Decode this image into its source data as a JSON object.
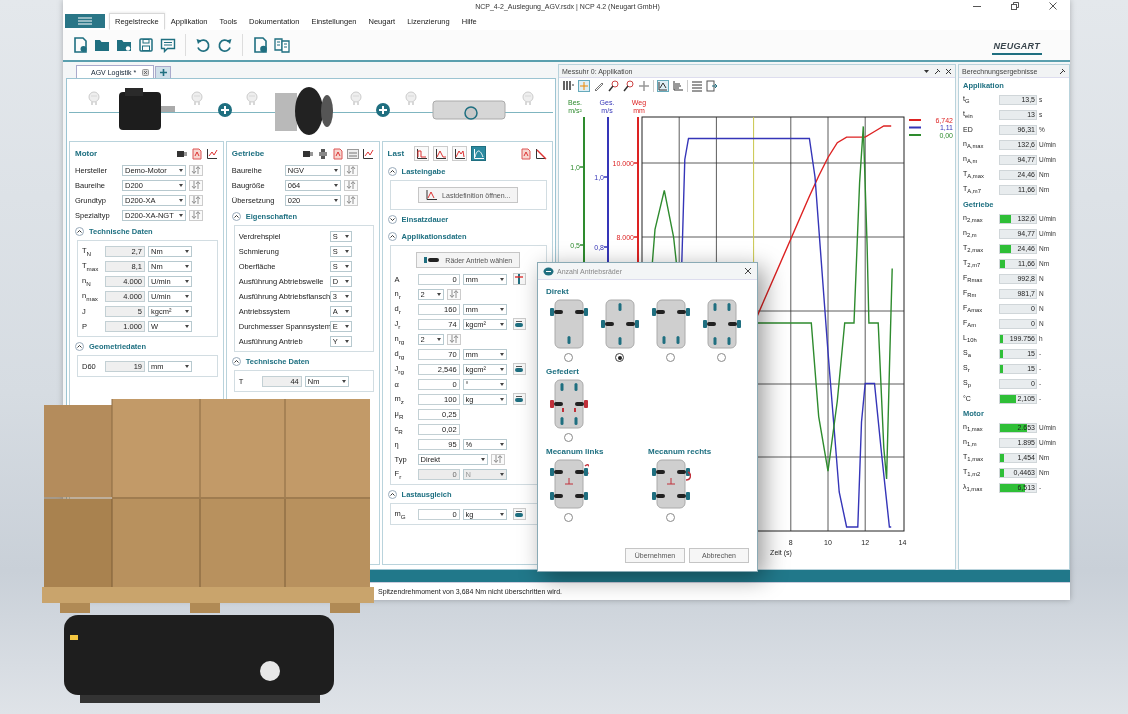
{
  "window": {
    "title": "NCP_4-2_Auslegung_AGV.rsdx | NCP 4.2 (Neugart GmbH)"
  },
  "menu": [
    {
      "label": "Regelstrecke",
      "selected": true
    },
    {
      "label": "Applikation",
      "selected": false
    },
    {
      "label": "Tools",
      "selected": false
    },
    {
      "label": "Dokumentation",
      "selected": false
    },
    {
      "label": "Einstellungen",
      "selected": false
    },
    {
      "label": "Neugart",
      "selected": false
    },
    {
      "label": "Lizenzierung",
      "selected": false
    },
    {
      "label": "Hilfe",
      "selected": false
    }
  ],
  "logo": "NEUGART",
  "document_tabs": [
    {
      "label": "AGV Logistik *",
      "selected": true
    }
  ],
  "panels": [
    {
      "kind": "motor",
      "title": "Motor",
      "rows": [
        {
          "kind": "select",
          "label": "Hersteller",
          "value": "Demo-Motor"
        },
        {
          "kind": "select",
          "label": "Baureihe",
          "value": "D200"
        },
        {
          "kind": "select",
          "label": "Grundtyp",
          "value": "D200-XA"
        },
        {
          "kind": "select",
          "label": "Spezialtyp",
          "value": "D200-XA-NGT"
        }
      ],
      "sections": [
        {
          "title": "Technische Daten",
          "expanded": true,
          "rows": [
            {
              "kind": "readout",
              "label": "T$_{N}$",
              "value": "2,7",
              "unit": "Nm"
            },
            {
              "kind": "readout",
              "label": "T$_{max}$",
              "value": "8,1",
              "unit": "Nm"
            },
            {
              "kind": "readout",
              "label": "n$_{N}$",
              "value": "4.000",
              "unit": "U/min"
            },
            {
              "kind": "readout",
              "label": "n$_{max}$",
              "value": "4.000",
              "unit": "U/min"
            },
            {
              "kind": "readout",
              "label": "J",
              "value": "5",
              "unit": "kgcm²"
            },
            {
              "kind": "readout",
              "label": "P",
              "value": "1.000",
              "unit": "W"
            }
          ]
        },
        {
          "title": "Geometriedaten",
          "expanded": true,
          "rows": [
            {
              "kind": "readout",
              "label": "D60",
              "value": "19",
              "unit": "mm"
            }
          ]
        }
      ]
    },
    {
      "kind": "gearbox",
      "title": "Getriebe",
      "rows": [
        {
          "kind": "select",
          "label": "Baureihe",
          "value": "NGV"
        },
        {
          "kind": "select",
          "label": "Baugröße",
          "value": "064"
        },
        {
          "kind": "select",
          "label": "Übersetzung",
          "value": "020"
        }
      ],
      "sections": [
        {
          "title": "Eigenschaften",
          "expanded": true,
          "rows": [
            {
              "kind": "choice",
              "label": "Verdrehspiel",
              "value": "S"
            },
            {
              "kind": "choice",
              "label": "Schmierung",
              "value": "S"
            },
            {
              "kind": "choice",
              "label": "Oberfläche",
              "value": "S"
            },
            {
              "kind": "choice",
              "label": "Ausführung Abtriebswelle",
              "value": "D"
            },
            {
              "kind": "choice",
              "label": "Ausführung Abtriebsflansch",
              "value": "3"
            },
            {
              "kind": "choice",
              "label": "Antriebssystem",
              "value": "A"
            },
            {
              "kind": "choice",
              "label": "Durchmesser Spannsystem",
              "value": "E"
            },
            {
              "kind": "choice",
              "label": "Ausführung Antrieb",
              "value": "Y"
            }
          ]
        },
        {
          "title": "Technische Daten",
          "expanded": true,
          "rows": [
            {
              "kind": "readout",
              "label": "T",
              "value": "44",
              "unit": "Nm"
            }
          ]
        }
      ]
    },
    {
      "kind": "load",
      "title": "Last",
      "load_types": [
        {
          "selected": false
        },
        {
          "selected": false
        },
        {
          "selected": false
        },
        {
          "selected": true
        }
      ],
      "sections": [
        {
          "title": "Lasteingabe",
          "expanded": true,
          "button": {
            "kind": "load",
            "label": "Lastdefinition öffnen..."
          }
        },
        {
          "title": "Einsatzdauer",
          "expanded": false
        },
        {
          "title": "Applikationsdaten",
          "expanded": true,
          "button": {
            "kind": "wheels",
            "label": "Räder Antrieb wählen"
          },
          "rows": [
            {
              "kind": "unit",
              "label": "A",
              "value": "0",
              "unit": "mm",
              "action": {
                "kind": "offset"
              }
            },
            {
              "kind": "count",
              "label": "n$_{r}$",
              "value": "2"
            },
            {
              "kind": "unit",
              "label": "d$_{r}$",
              "value": "160",
              "unit": "mm"
            },
            {
              "kind": "unit",
              "label": "J$_{r}$",
              "value": "74",
              "unit": "kgcm²",
              "action": {
                "kind": "calc"
              }
            },
            {
              "kind": "count",
              "label": "n$_{rg}$",
              "value": "2"
            },
            {
              "kind": "unit",
              "label": "d$_{rg}$",
              "value": "70",
              "unit": "mm"
            },
            {
              "kind": "unit",
              "label": "J$_{rg}$",
              "value": "2,546",
              "unit": "kgcm²",
              "action": {
                "kind": "calc"
              }
            },
            {
              "kind": "unit",
              "label": "α",
              "value": "0",
              "unit": "°"
            },
            {
              "kind": "unit",
              "label": "m$_{z}$",
              "value": "100",
              "unit": "kg",
              "action": {
                "kind": "calc"
              }
            },
            {
              "kind": "plain",
              "label": "μ$_{R}$",
              "value": "0,25"
            },
            {
              "kind": "plain",
              "label": "c$_{R}$",
              "value": "0,02"
            },
            {
              "kind": "unit",
              "label": "η",
              "value": "95",
              "unit": "%"
            },
            {
              "kind": "select",
              "label": "Typ",
              "value": "Direkt"
            },
            {
              "kind": "disabled",
              "label": "F$_{r}$",
              "value": "0",
              "unit": "N"
            }
          ]
        },
        {
          "title": "Lastausgleich",
          "expanded": true,
          "rows": [
            {
              "kind": "unit",
              "label": "m$_{G}$",
              "value": "0",
              "unit": "kg",
              "action": {
                "kind": "calc"
              }
            }
          ]
        }
      ]
    }
  ],
  "chart": {
    "title": "Messuhr 0: Applikation",
    "axes": [
      {
        "name": "Bes.",
        "unit": "m/s²",
        "color": "#2e8b2e",
        "ticks": [
          "1,0",
          "0,5"
        ]
      },
      {
        "name": "Ges.",
        "unit": "m/s",
        "color": "#3535b8",
        "ticks": [
          "1,0",
          "0,8"
        ]
      },
      {
        "name": "Weg",
        "unit": "mm",
        "color": "#dd2222",
        "ticks": [
          "10.000",
          "8.000"
        ]
      }
    ],
    "x_ticks": [
      "8",
      "10",
      "12",
      "14"
    ],
    "x_label": "Zeit (s)",
    "legend": [
      {
        "color": "#dd2222",
        "value": "6,742"
      },
      {
        "color": "#3535b8",
        "value": "1,11"
      },
      {
        "color": "#2e8b2e",
        "value": "0,00"
      }
    ]
  },
  "results": {
    "title": "Berechnungsergebnisse",
    "sections": [
      {
        "title": "Applikation",
        "rows": [
          {
            "label": "t$_{G}$",
            "value": "13,5",
            "unit": "s"
          },
          {
            "label": "t$_{ein}$",
            "value": "13",
            "unit": "s"
          },
          {
            "label": "ED",
            "value": "96,31",
            "unit": "%"
          },
          {
            "label": "n$_{A,max}$",
            "value": "132,6",
            "unit": "U/min"
          },
          {
            "label": "n$_{A,m}$",
            "value": "94,77",
            "unit": "U/min"
          },
          {
            "label": "T$_{A,max}$",
            "value": "24,46",
            "unit": "Nm"
          },
          {
            "label": "T$_{A,m7}$",
            "value": "11,66",
            "unit": "Nm"
          }
        ]
      },
      {
        "title": "Getriebe",
        "rows": [
          {
            "label": "n$_{2,max}$",
            "value": "132,6",
            "unit": "U/min",
            "level": 0.3
          },
          {
            "label": "n$_{2,m}$",
            "value": "94,77",
            "unit": "U/min"
          },
          {
            "label": "T$_{2,max}$",
            "value": "24,46",
            "unit": "Nm",
            "level": 0.3
          },
          {
            "label": "T$_{2,m7}$",
            "value": "11,66",
            "unit": "Nm",
            "level": 0.15
          },
          {
            "label": "F$_{Rmax}$",
            "value": "992,8",
            "unit": "N"
          },
          {
            "label": "F$_{Rm}$",
            "value": "981,7",
            "unit": "N"
          },
          {
            "label": "F$_{Amax}$",
            "value": "0",
            "unit": "N"
          },
          {
            "label": "F$_{Am}$",
            "value": "0",
            "unit": "N"
          },
          {
            "label": "L$_{10h}$",
            "value": "199.756",
            "unit": "h",
            "level": 0.08
          },
          {
            "label": "S$_{a}$",
            "value": "15",
            "unit": "-",
            "level": 0.08
          },
          {
            "label": "S$_{r}$",
            "value": "15",
            "unit": "-",
            "level": 0.08
          },
          {
            "label": "S$_{p}$",
            "value": "0",
            "unit": "-"
          },
          {
            "label": "°C",
            "value": "2,105",
            "unit": "-",
            "level": 0.45
          }
        ]
      },
      {
        "title": "Motor",
        "rows": [
          {
            "label": "n$_{1,max}$",
            "value": "2.653",
            "unit": "U/min",
            "level": 0.75
          },
          {
            "label": "n$_{1,m}$",
            "value": "1.895",
            "unit": "U/min"
          },
          {
            "label": "T$_{1,max}$",
            "value": "1,454",
            "unit": "Nm",
            "level": 0.12
          },
          {
            "label": "T$_{1,m2}$",
            "value": "0,4463",
            "unit": "Nm",
            "level": 0.1
          },
          {
            "label": "λ$_{1,max}$",
            "value": "6,513",
            "unit": "-",
            "level": 0.7
          }
        ]
      }
    ]
  },
  "dialog": {
    "title": "Anzahl Antriebsräder",
    "rows": [
      [
        {
          "title": "Direkt",
          "options": [
            {
              "kind": "trifront",
              "selected": false
            },
            {
              "kind": "diamond",
              "selected": true
            },
            {
              "kind": "trirear",
              "selected": false
            },
            {
              "kind": "cross",
              "selected": false
            }
          ]
        }
      ],
      [
        {
          "title": "Gefedert",
          "options": [
            {
              "kind": "sprung",
              "selected": false
            }
          ]
        }
      ],
      [
        {
          "title": "Mecanum links",
          "options": [
            {
              "kind": "mecanumleft",
              "selected": false
            }
          ]
        },
        {
          "title": "Mecanum rechts",
          "options": [
            {
              "kind": "mecanumright",
              "selected": false
            }
          ]
        }
      ]
    ],
    "buttons": [
      "Übernehmen",
      "Abbrechen"
    ]
  },
  "status": "Spitzendrehmoment von 3,684 Nm nicht überschritten wird."
}
